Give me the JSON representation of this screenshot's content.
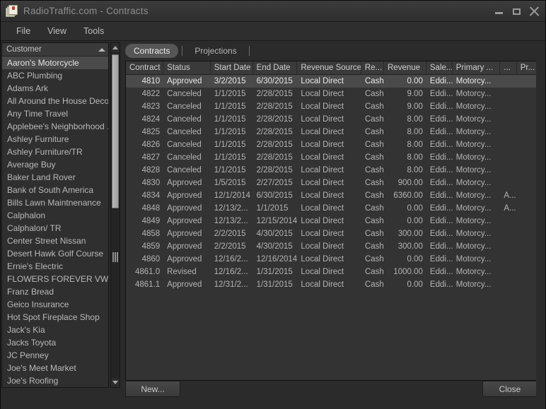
{
  "window": {
    "title": "RadioTraffic.com - Contracts",
    "icon": "note-document-icon",
    "controls": {
      "minimize": "minimize-icon",
      "maximize": "maximize-icon",
      "close": "close-icon"
    }
  },
  "menubar": {
    "items": [
      "File",
      "View",
      "Tools"
    ]
  },
  "sidebar": {
    "header_label": "Customer",
    "sort_indicator": "sort-ascending-icon",
    "selected_index": 0,
    "items": [
      "Aaron's Motorcycle",
      "ABC Plumbing",
      "Adams Ark",
      "All Around the House Decor",
      "Any Time Travel",
      "Applebee's Neighborhood ...",
      "Ashley Furniture",
      "Ashley Furniture/TR",
      "Average Buy",
      "Baker Land Rover",
      "Bank of South America",
      "Bills Lawn Maintnenance",
      "Calphalon",
      "Calphalon/ TR",
      "Center Street Nissan",
      "Desert Hawk Golf Course",
      "Ernie's Electric",
      "FLOWERS FOREVER  VW",
      "Franz Bread",
      "Geico Insurance",
      "Hot Spot Fireplace Shop",
      "Jack's Kia",
      "Jacks Toyota",
      "JC Penney",
      "Joe's Meet Market",
      "Joe's Roofing"
    ]
  },
  "tabs": [
    {
      "label": "Contracts",
      "active": true
    },
    {
      "label": "Projections",
      "active": false
    }
  ],
  "grid": {
    "columns": [
      "Contract",
      "Status",
      "Start Date",
      "End Date",
      "Revenue Source",
      "Re...",
      "Revenue",
      "Sale...",
      "Primary ...",
      "...",
      "Pr..."
    ],
    "selected_row": 0,
    "rows": [
      [
        "4810",
        "Approved",
        "3/2/2015",
        "6/30/2015",
        "Local Direct",
        "Cash",
        "0.00",
        "Eddi...",
        "Motorcy...",
        "",
        ""
      ],
      [
        "4822",
        "Canceled",
        "1/1/2015",
        "2/28/2015",
        "Local Direct",
        "Cash",
        "9.00",
        "Eddi...",
        "Motorcy...",
        "",
        ""
      ],
      [
        "4823",
        "Canceled",
        "1/1/2015",
        "2/28/2015",
        "Local Direct",
        "Cash",
        "9.00",
        "Eddi...",
        "Motorcy...",
        "",
        ""
      ],
      [
        "4824",
        "Canceled",
        "1/1/2015",
        "2/28/2015",
        "Local Direct",
        "Cash",
        "8.00",
        "Eddi...",
        "Motorcy...",
        "",
        ""
      ],
      [
        "4825",
        "Canceled",
        "1/1/2015",
        "2/28/2015",
        "Local Direct",
        "Cash",
        "8.00",
        "Eddi...",
        "Motorcy...",
        "",
        ""
      ],
      [
        "4826",
        "Canceled",
        "1/1/2015",
        "2/28/2015",
        "Local Direct",
        "Cash",
        "8.00",
        "Eddi...",
        "Motorcy...",
        "",
        ""
      ],
      [
        "4827",
        "Canceled",
        "1/1/2015",
        "2/28/2015",
        "Local Direct",
        "Cash",
        "8.00",
        "Eddi...",
        "Motorcy...",
        "",
        ""
      ],
      [
        "4828",
        "Canceled",
        "1/1/2015",
        "2/28/2015",
        "Local Direct",
        "Cash",
        "8.00",
        "Eddi...",
        "Motorcy...",
        "",
        ""
      ],
      [
        "4830",
        "Approved",
        "1/5/2015",
        "2/27/2015",
        "Local Direct",
        "Cash",
        "900.00",
        "Eddi...",
        "Motorcy...",
        "",
        ""
      ],
      [
        "4834",
        "Approved",
        "12/1/2014",
        "6/30/2015",
        "Local Direct",
        "Cash",
        "6360.00",
        "Eddi...",
        "Motorcy...",
        "A...",
        ""
      ],
      [
        "4848",
        "Approved",
        "12/13/2...",
        "1/1/2015",
        "Local Direct",
        "Cash",
        "0.00",
        "Eddi...",
        "Motorcy...",
        "A...",
        ""
      ],
      [
        "4849",
        "Approved",
        "12/13/2...",
        "12/15/2014",
        "Local Direct",
        "Cash",
        "0.00",
        "Eddi...",
        "Motorcy...",
        "",
        ""
      ],
      [
        "4858",
        "Approved",
        "2/2/2015",
        "4/30/2015",
        "Local Direct",
        "Cash",
        "300.00",
        "Eddi...",
        "Motorcy...",
        "",
        ""
      ],
      [
        "4859",
        "Approved",
        "2/2/2015",
        "4/30/2015",
        "Local Direct",
        "Cash",
        "300.00",
        "Eddi...",
        "Motorcy...",
        "",
        ""
      ],
      [
        "4860",
        "Approved",
        "12/16/2...",
        "12/16/2014",
        "Local Direct",
        "Cash",
        "0.00",
        "Eddi...",
        "Motorcy...",
        "",
        ""
      ],
      [
        "4861.0",
        "Revised",
        "12/16/2...",
        "1/31/2015",
        "Local Direct",
        "Cash",
        "1000.00",
        "Eddi...",
        "Motorcy...",
        "",
        ""
      ],
      [
        "4861.1",
        "Approved",
        "12/31/2...",
        "1/31/2015",
        "Local Direct",
        "Cash",
        "0.00",
        "Eddi...",
        "Motorcy...",
        "",
        ""
      ]
    ]
  },
  "footer": {
    "new_label": "New...",
    "close_label": "Close"
  },
  "colors": {
    "window_bg": "#2b2b2b",
    "titlebar": "#353535",
    "grid_bg": "#333333",
    "header_bg": "#3a3a3a",
    "selection": "#4a4a4a",
    "text": "#b4b4b4",
    "title_text": "#8e8e8e"
  }
}
